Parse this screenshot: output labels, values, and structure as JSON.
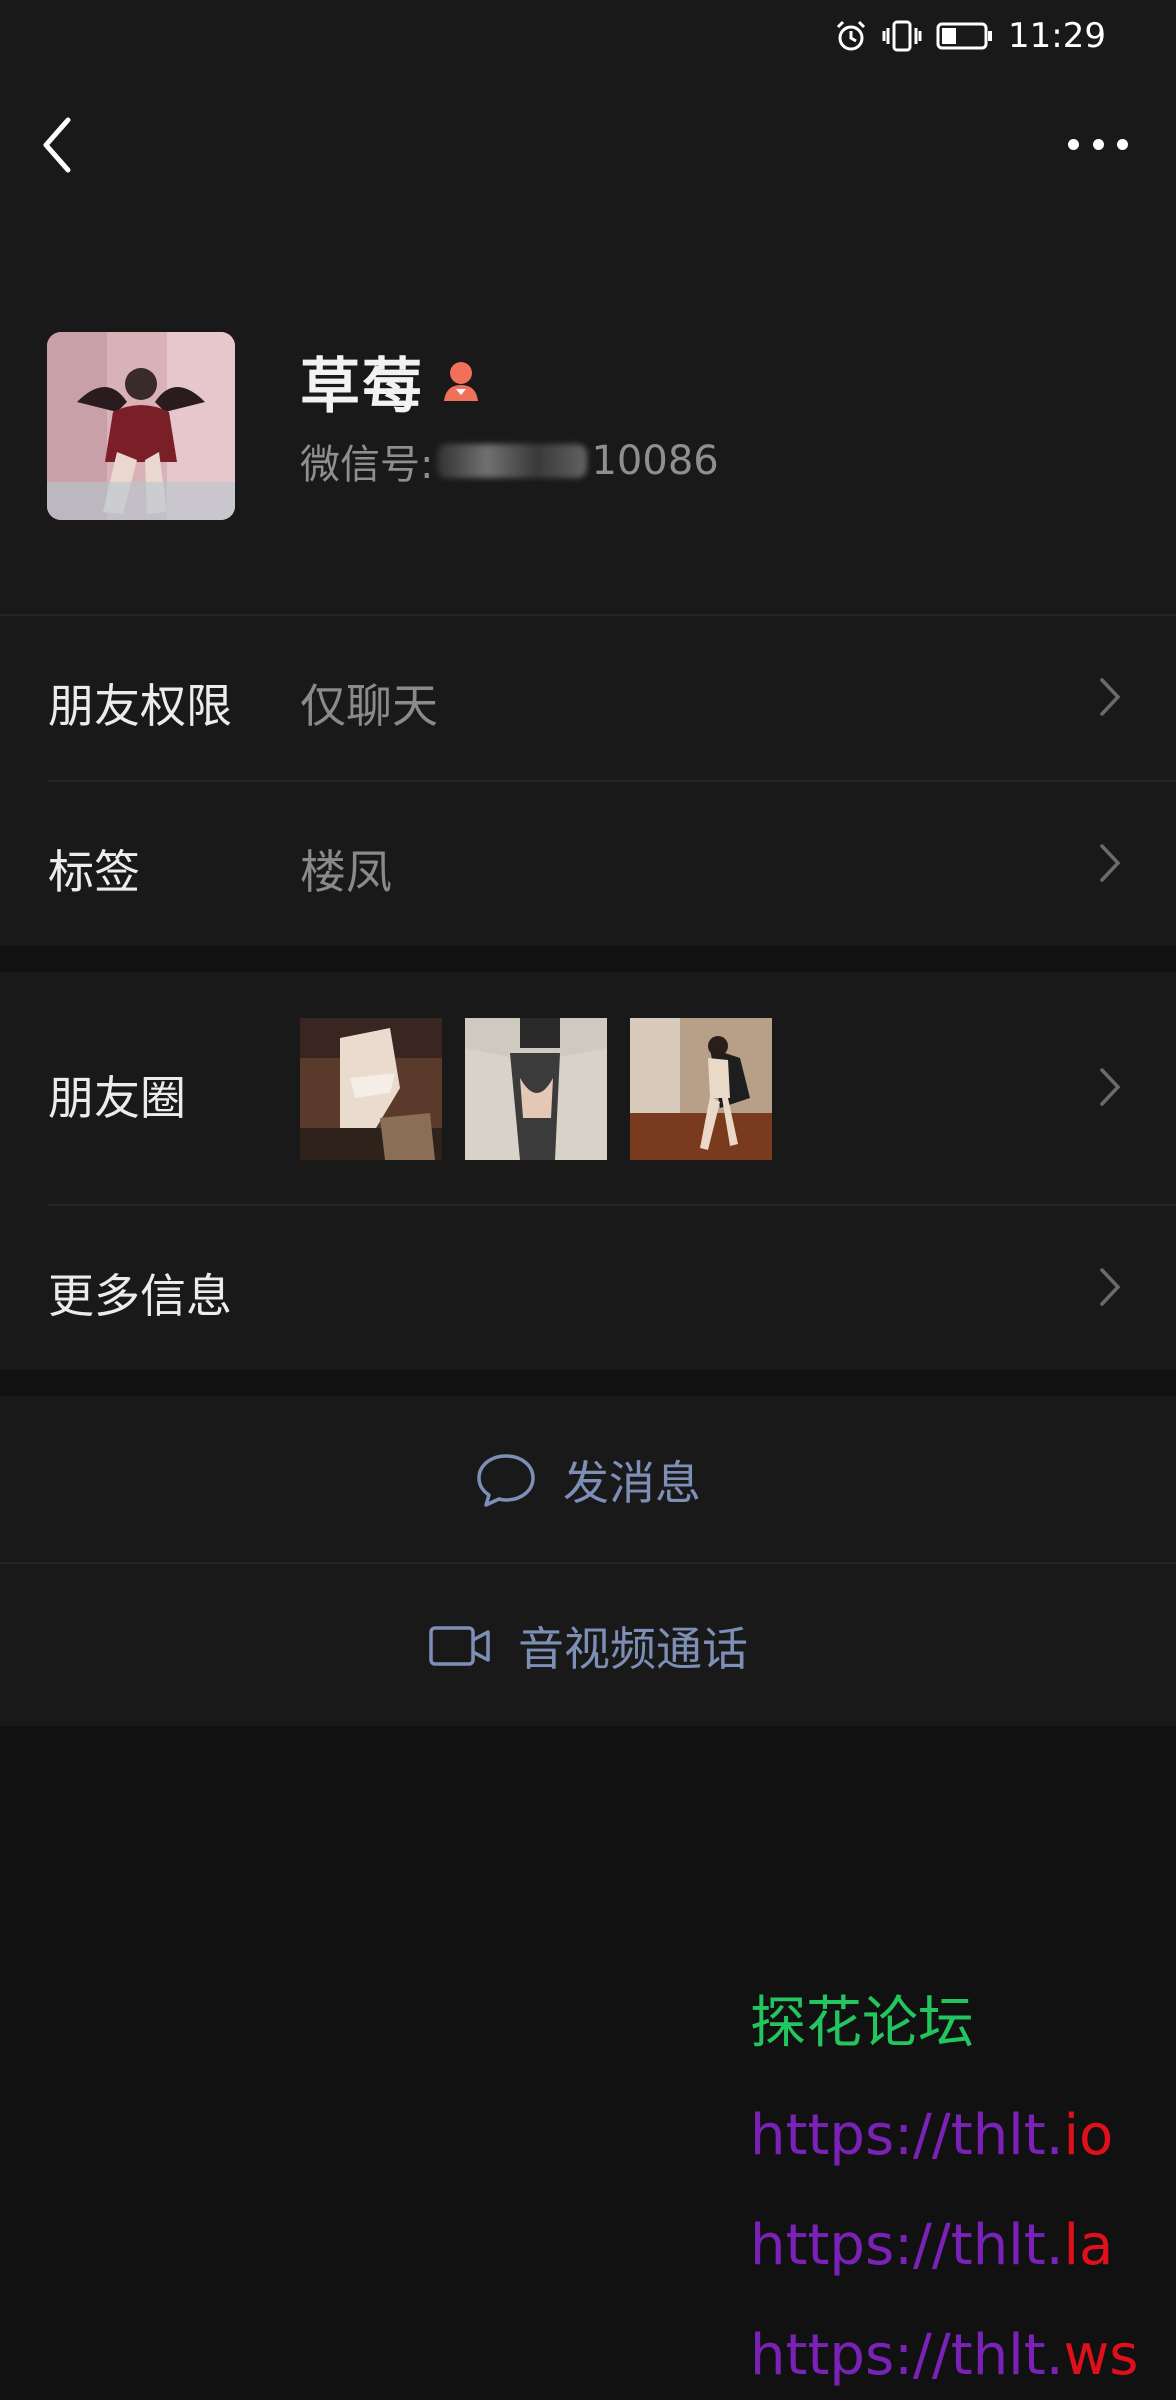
{
  "status_bar": {
    "time": "11:29",
    "icons": [
      "alarm-icon",
      "vibrate-icon",
      "battery-icon"
    ],
    "battery_level": 0.35
  },
  "nav": {
    "back_icon": "chevron-left-icon",
    "more_icon": "more-dots-icon"
  },
  "profile": {
    "name": "草莓",
    "gender_icon": "female-icon",
    "wechat_id_label": "微信号:",
    "wechat_id_visible": "10086"
  },
  "rows": {
    "permissions": {
      "label": "朋友权限",
      "value": "仅聊天"
    },
    "tags": {
      "label": "标签",
      "value": "楼凤"
    },
    "moments": {
      "label": "朋友圈"
    },
    "more_info": {
      "label": "更多信息"
    }
  },
  "actions": {
    "message": {
      "label": "发消息",
      "icon": "chat-bubble-icon"
    },
    "call": {
      "label": "音视频通话",
      "icon": "video-camera-icon"
    }
  },
  "watermark": {
    "title": "探花论坛",
    "links": [
      {
        "prefix": "https://thlt.",
        "suffix": "io"
      },
      {
        "prefix": "https://thlt.",
        "suffix": "la"
      },
      {
        "prefix": "https://thlt.",
        "suffix": "ws"
      }
    ]
  },
  "colors": {
    "background": "#111111",
    "panel": "#191919",
    "action_text": "#7e8fb6",
    "gender_female": "#f0705a",
    "watermark_green": "#22c55e",
    "watermark_purple": "#7a22b8",
    "watermark_red": "#e0101a"
  }
}
